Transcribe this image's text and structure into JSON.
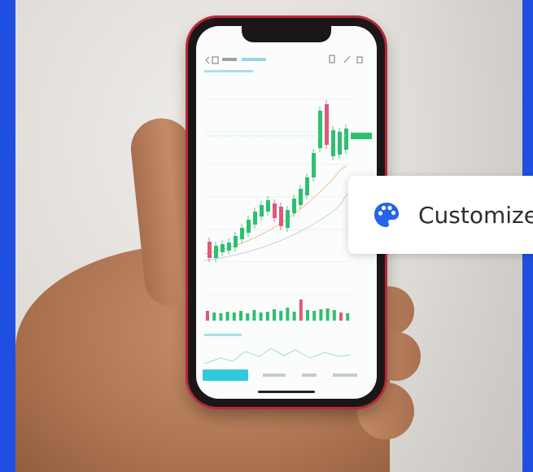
{
  "phone_app": {
    "icons": [
      "back-icon",
      "menu-icon",
      "share-icon",
      "edit-icon",
      "more-icon"
    ]
  },
  "customize": {
    "label": "Customize",
    "icon": "palette-icon"
  },
  "colors": {
    "frame_blue": "#1f4fe0",
    "bull_green": "#2fbf71",
    "bear_red": "#e0587a",
    "accent_cyan": "#33c9dc",
    "palette_blue": "#2563eb"
  }
}
